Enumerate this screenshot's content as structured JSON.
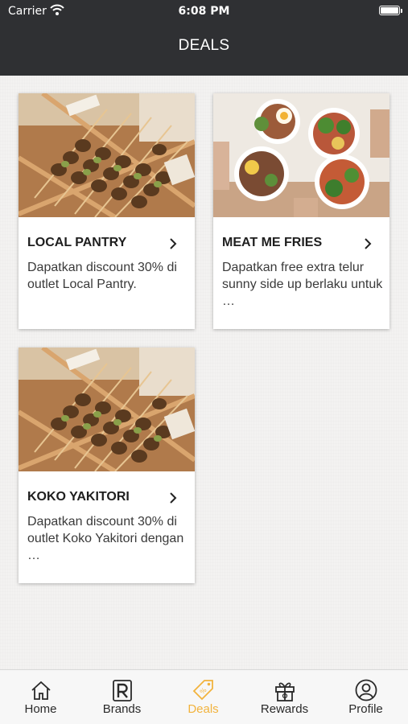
{
  "status_bar": {
    "carrier": "Carrier",
    "time": "6:08 PM"
  },
  "header": {
    "title": "DEALS"
  },
  "deals": [
    {
      "name": "LOCAL PANTRY",
      "description": "Dapatkan discount 30% di outlet Local Pantry.",
      "image": "skewers-photo"
    },
    {
      "name": "MEAT ME FRIES",
      "description": "Dapatkan free extra telur sunny side up berlaku untuk …",
      "image": "rice-bowls-photo"
    },
    {
      "name": "KOKO YAKITORI",
      "description": "Dapatkan discount 30% di outlet Koko Yakitori dengan …",
      "image": "skewers-photo"
    }
  ],
  "tabbar": {
    "items": [
      {
        "label": "Home",
        "icon": "home-icon"
      },
      {
        "label": "Brands",
        "icon": "brands-icon"
      },
      {
        "label": "Deals",
        "icon": "deals-tag-icon"
      },
      {
        "label": "Rewards",
        "icon": "rewards-gift-icon"
      },
      {
        "label": "Profile",
        "icon": "profile-icon"
      }
    ],
    "active": "Deals",
    "active_color": "#f2b33d"
  },
  "colors": {
    "header_bg": "#2f3033",
    "page_bg": "#f3f2f1",
    "card_bg": "#ffffff"
  }
}
